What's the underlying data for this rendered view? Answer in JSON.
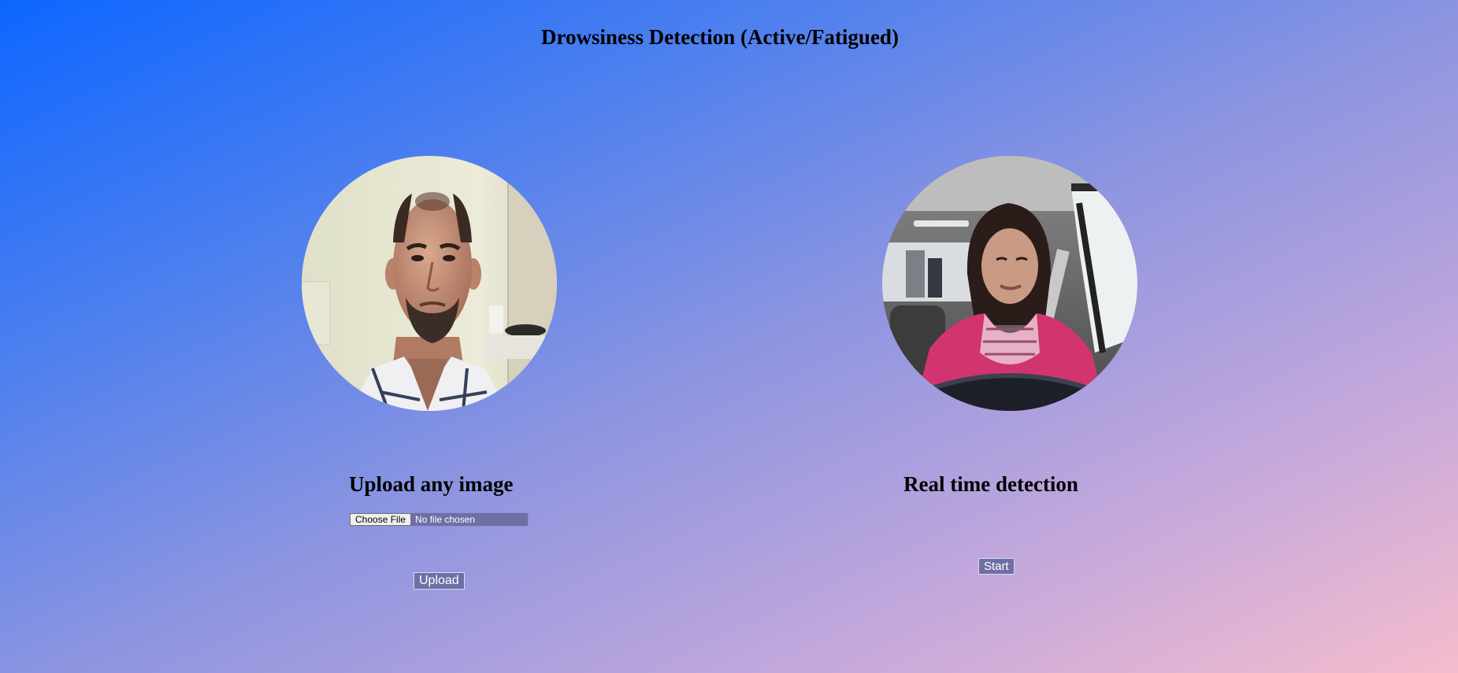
{
  "page": {
    "title": "Drowsiness Detection (Active/Fatigued)"
  },
  "left_panel": {
    "image_name": "man-face-photo",
    "heading": "Upload any image",
    "file_input": {
      "button_label": "Choose File",
      "status": "No file chosen"
    },
    "upload_button": "Upload"
  },
  "right_panel": {
    "image_name": "woman-driving-photo",
    "heading": "Real time detection",
    "start_button": "Start"
  },
  "colors": {
    "gradient_start": "#0d66ff",
    "gradient_end": "#f5bccd",
    "button_bg": "#6f6fa6"
  }
}
